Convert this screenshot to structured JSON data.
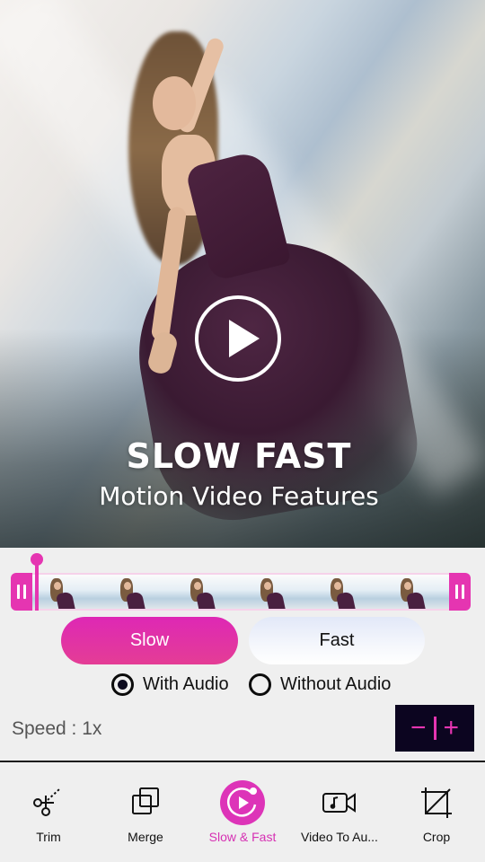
{
  "preview": {
    "title_main": "SLOW FAST",
    "title_sub": "Motion Video Features",
    "play_icon": "play-circle-icon"
  },
  "timeline": {
    "frame_count": 6,
    "accent_color": "#e535b1",
    "left_handle_icon": "pause-grip-icon",
    "right_handle_icon": "pause-grip-icon"
  },
  "mode": {
    "slow_label": "Slow",
    "fast_label": "Fast",
    "selected": "Slow"
  },
  "audio": {
    "with_audio_label": "With Audio",
    "without_audio_label": "Without Audio",
    "selected": "With Audio"
  },
  "speed": {
    "label": "Speed : 1x",
    "decrease_symbol": "−",
    "increase_symbol": "+"
  },
  "nav": {
    "items": [
      {
        "label": "Trim",
        "icon": "scissors-icon",
        "active": false
      },
      {
        "label": "Merge",
        "icon": "merge-icon",
        "active": false
      },
      {
        "label": "Slow & Fast",
        "icon": "slow-fast-icon",
        "active": true
      },
      {
        "label": "Video To Au...",
        "icon": "video-to-audio-icon",
        "active": false
      },
      {
        "label": "Crop",
        "icon": "crop-icon",
        "active": false
      }
    ]
  },
  "colors": {
    "accent": "#e535b1",
    "active_label": "#d630b3",
    "speed_bg": "#0c0520"
  }
}
